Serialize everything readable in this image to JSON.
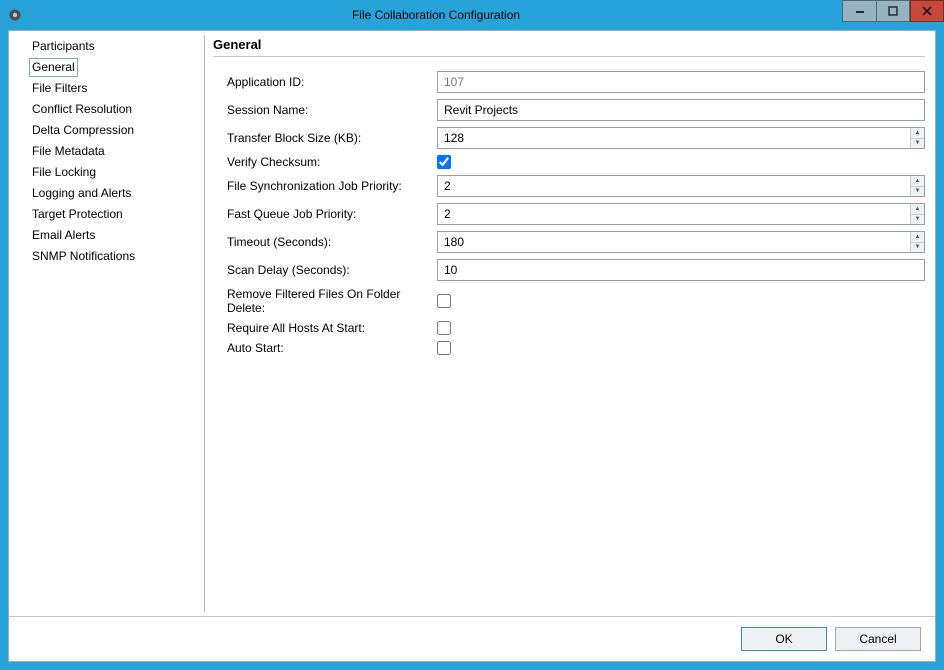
{
  "window": {
    "title": "File Collaboration Configuration"
  },
  "sidebar": {
    "items": [
      {
        "label": "Participants"
      },
      {
        "label": "General"
      },
      {
        "label": "File Filters"
      },
      {
        "label": "Conflict Resolution"
      },
      {
        "label": "Delta Compression"
      },
      {
        "label": "File Metadata"
      },
      {
        "label": "File Locking"
      },
      {
        "label": "Logging and Alerts"
      },
      {
        "label": "Target Protection"
      },
      {
        "label": "Email Alerts"
      },
      {
        "label": "SNMP Notifications"
      }
    ],
    "selected_index": 1
  },
  "section_title": "General",
  "fields": {
    "application_id": {
      "label": "Application ID:",
      "value": "107"
    },
    "session_name": {
      "label": "Session Name:",
      "value": "Revit Projects"
    },
    "transfer_block": {
      "label": "Transfer Block Size (KB):",
      "value": "128"
    },
    "verify_checksum": {
      "label": "Verify Checksum:",
      "checked": true
    },
    "sync_priority": {
      "label": "File Synchronization Job Priority:",
      "value": "2"
    },
    "fast_queue": {
      "label": "Fast Queue Job Priority:",
      "value": "2"
    },
    "timeout": {
      "label": "Timeout (Seconds):",
      "value": "180"
    },
    "scan_delay": {
      "label": "Scan Delay (Seconds):",
      "value": "10"
    },
    "remove_filtered": {
      "label": "Remove Filtered Files On Folder Delete:",
      "checked": false
    },
    "require_hosts": {
      "label": "Require All Hosts At Start:",
      "checked": false
    },
    "auto_start": {
      "label": "Auto Start:",
      "checked": false
    }
  },
  "buttons": {
    "ok": "OK",
    "cancel": "Cancel"
  }
}
